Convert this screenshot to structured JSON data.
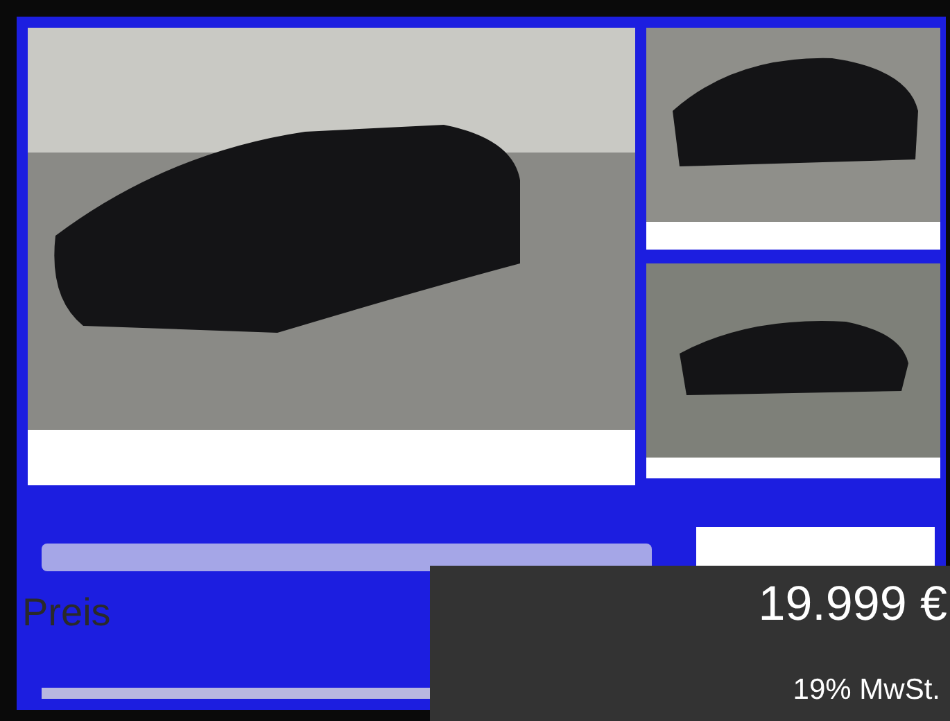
{
  "price_label": "Preis",
  "price_panel": {
    "price": "19.999 €",
    "tax_note": "19% MwSt."
  }
}
